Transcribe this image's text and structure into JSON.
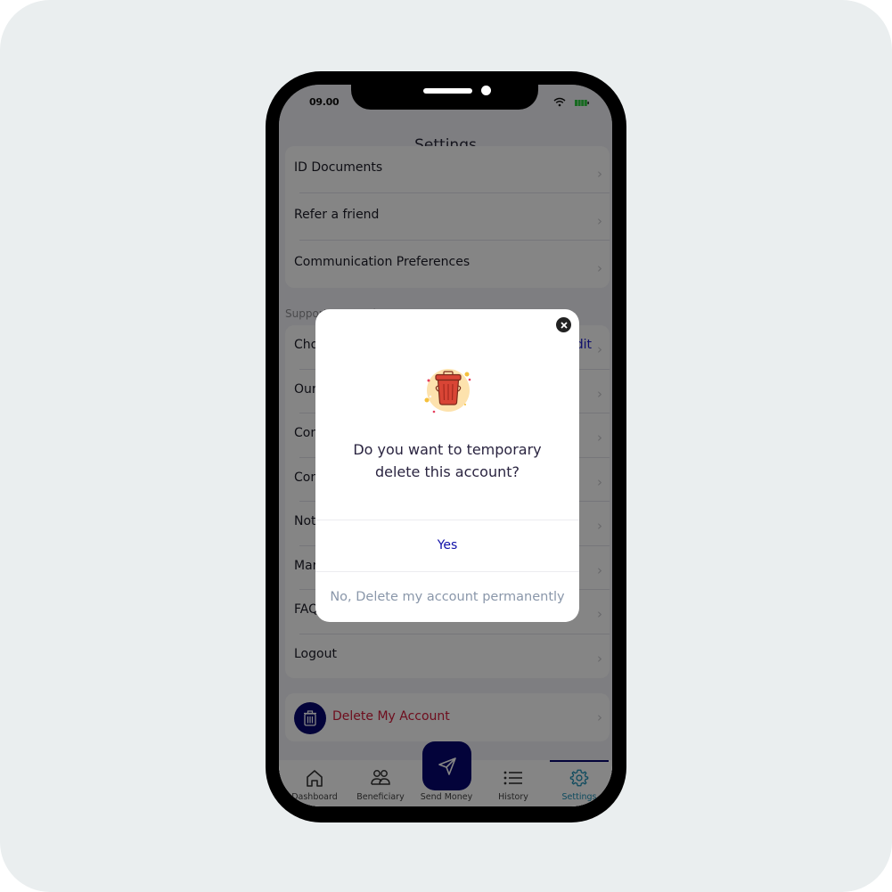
{
  "status_bar": {
    "time": "09.00",
    "wifi_icon": "wifi-icon",
    "battery_icon": "battery-icon"
  },
  "header": {
    "title": "Settings"
  },
  "account_group": {
    "items": [
      {
        "label": "ID Documents"
      },
      {
        "label": "Refer a friend"
      },
      {
        "label": "Communication Preferences"
      }
    ]
  },
  "support_security": {
    "header": "Support & Security",
    "items": [
      {
        "label": "Cho",
        "trailing": "Edit"
      },
      {
        "label": "Our"
      },
      {
        "label": "Con"
      },
      {
        "label": "Con"
      },
      {
        "label": "Not"
      },
      {
        "label": "Mar"
      },
      {
        "label": "FAQ"
      },
      {
        "label": "Logout"
      }
    ]
  },
  "delete_account": {
    "label": "Delete My Account",
    "icon": "trash-icon",
    "color": "#d31c3a"
  },
  "tabbar": {
    "tabs": [
      {
        "label": "Dashboard",
        "icon": "home-icon"
      },
      {
        "label": "Beneficiary",
        "icon": "users-icon"
      },
      {
        "label": "Send Money",
        "icon": "send-icon"
      },
      {
        "label": "History",
        "icon": "list-icon"
      },
      {
        "label": "Settings",
        "icon": "gear-icon",
        "active": true
      }
    ],
    "active_color": "#1a8fb5",
    "brand_color": "#06066f"
  },
  "modal": {
    "illustration": "trash-bin-icon",
    "question": "Do you want to temporary delete this account?",
    "yes_label": "Yes",
    "permanent_label": "No, Delete my account permanently",
    "close_icon": "close-icon"
  }
}
